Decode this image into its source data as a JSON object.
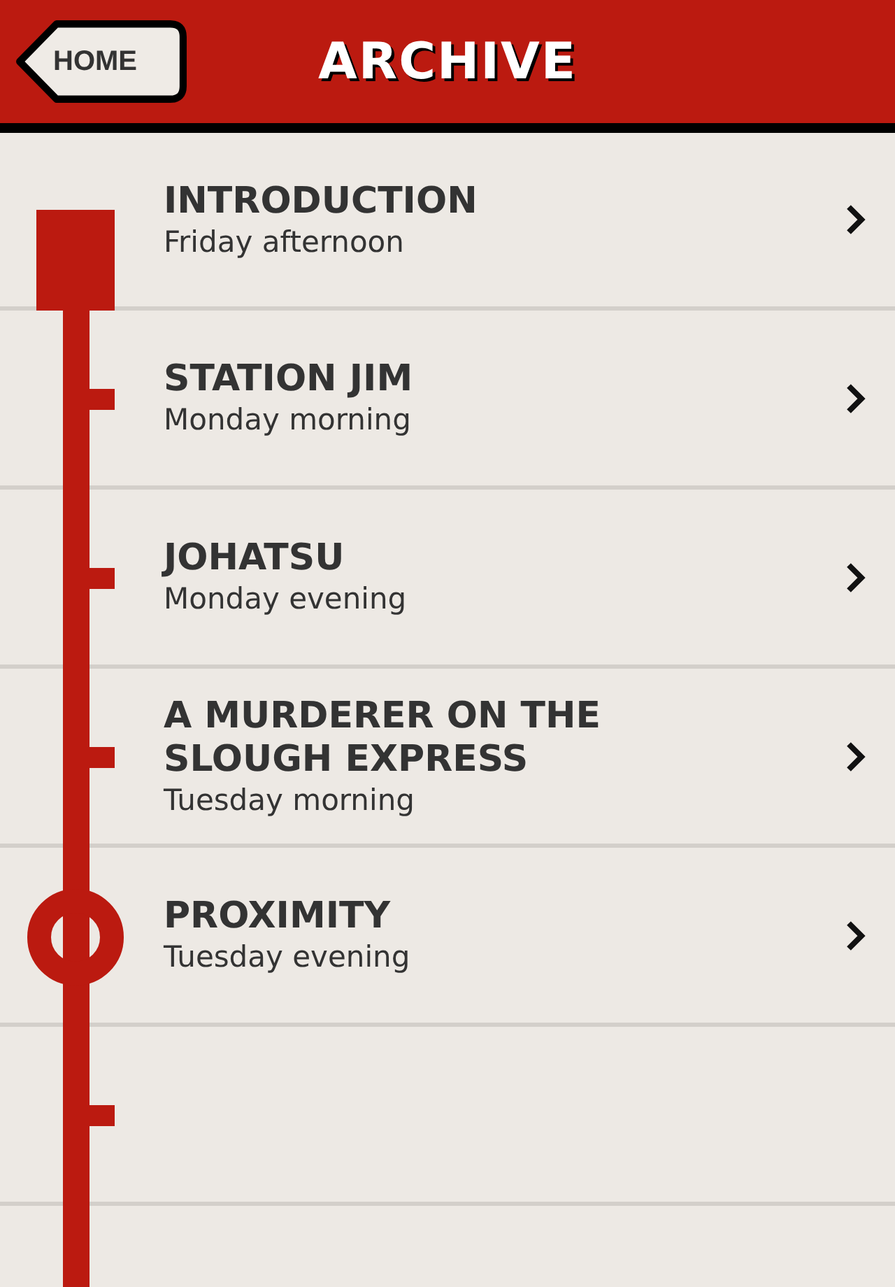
{
  "header": {
    "back_button": "HOME",
    "title": "ARCHIVE"
  },
  "items": [
    {
      "title": "INTRODUCTION",
      "subtitle": "Friday afternoon",
      "current": false
    },
    {
      "title": "STATION JIM",
      "subtitle": "Monday morning",
      "current": false
    },
    {
      "title": "JOHATSU",
      "subtitle": "Monday evening",
      "current": false
    },
    {
      "title": "A MURDERER ON THE SLOUGH EXPRESS",
      "subtitle": "Tuesday morning",
      "current": false
    },
    {
      "title": "PROXIMITY",
      "subtitle": "Tuesday evening",
      "current": true
    }
  ]
}
